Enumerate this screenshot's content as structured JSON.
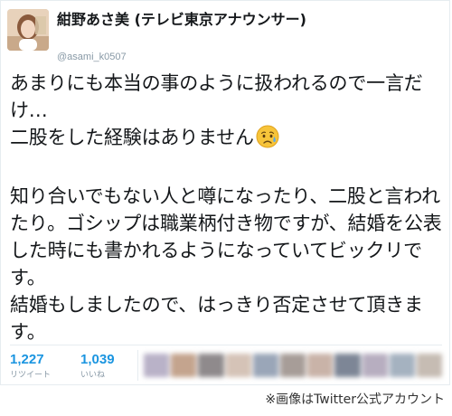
{
  "author": {
    "name": "紺野あさ美 (テレビ東京アナウンサー)",
    "handle": "@asami_k0507"
  },
  "tweet": {
    "lines": [
      "あまりにも本当の事のように扱われるので一言だけ…",
      "二股をした経験はありません"
    ],
    "emoji": "disappointed-but-relieved-face-icon",
    "paragraph2": "知り合いでもない人と噂になったり、二股と言われたり。ゴシップは職業柄付き物ですが、結婚を公表した時にも書かれるようになっていてビックリです。",
    "paragraph3": "結婚もしましたので、はっきり否定させて頂きます。"
  },
  "stats": {
    "retweets": {
      "count": "1,227",
      "label": "リツイート"
    },
    "likes": {
      "count": "1,039",
      "label": "いいね"
    }
  },
  "likers_strip": {
    "state": "blurred",
    "colors": [
      "#b9b2c8",
      "#c4a48e",
      "#8f8a8c",
      "#d5c3b7",
      "#9aa6b8",
      "#a79d98",
      "#c9b3a8",
      "#7d8696",
      "#b7aec0",
      "#a5b2c0",
      "#c6bcb3"
    ]
  },
  "caption": "※画像はTwitter公式アカウント",
  "colors": {
    "link_blue": "#1b95e0",
    "muted_gray": "#8899a6",
    "text": "#14171a",
    "border": "#e6ecf0"
  }
}
